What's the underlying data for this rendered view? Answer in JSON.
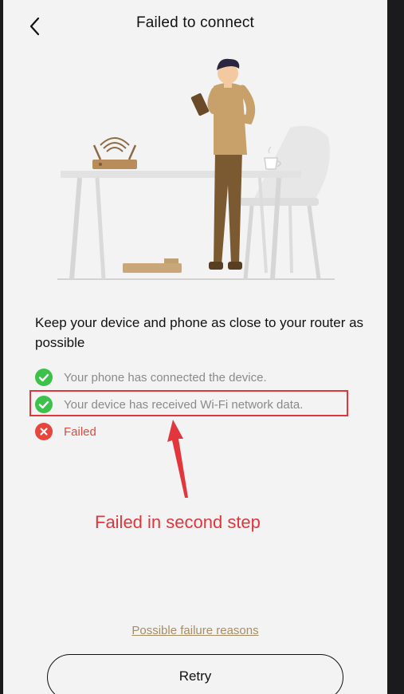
{
  "header": {
    "title": "Failed to connect",
    "back_icon": "chevron-left-icon"
  },
  "illustration": {
    "description_icon": "man-with-router-table-chair-illustration"
  },
  "main": {
    "headline": "Keep your device and phone as close to your router as possible",
    "steps": [
      {
        "label": "Your phone has connected the device.",
        "status": "success",
        "icon": "check-circle-icon"
      },
      {
        "label": "Your device has received Wi-Fi network data.",
        "status": "success",
        "icon": "check-circle-icon"
      },
      {
        "label": "Failed",
        "status": "error",
        "icon": "x-circle-icon"
      }
    ]
  },
  "annotation": {
    "text": "Failed in second step",
    "color": "#e2363c"
  },
  "footer": {
    "reasons_link": "Possible failure reasons",
    "retry_label": "Retry"
  },
  "colors": {
    "success": "#3cc24a",
    "error": "#e04a3f",
    "link": "#a88d62",
    "background": "#f3f3f3"
  }
}
